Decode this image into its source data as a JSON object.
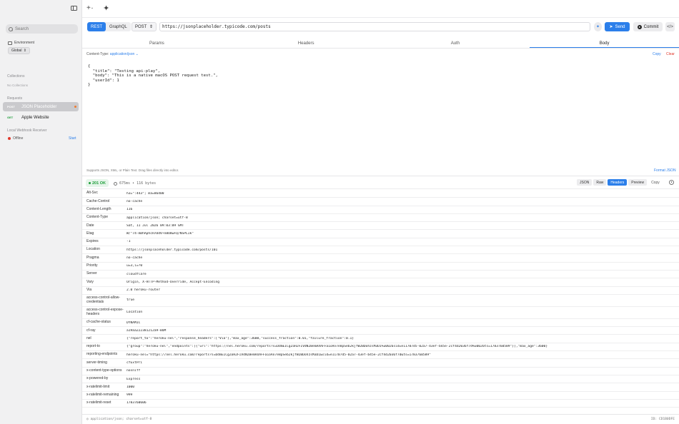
{
  "sidebar": {
    "search_placeholder": "Search",
    "environment_label": "Environment",
    "environment_value": "Global",
    "collections_title": "Collections",
    "collections_empty": "No Collections",
    "requests_title": "Requests",
    "requests": [
      {
        "method": "POST",
        "name": "JSON Placeholder",
        "selected": true,
        "modified": true
      },
      {
        "method": "GET",
        "name": "Apple Website",
        "selected": false,
        "modified": false
      }
    ],
    "webhook_title": "Local Webhook Receiver",
    "webhook_status": "Offline",
    "webhook_start": "Start"
  },
  "topbar": {
    "add_icon": "+",
    "chevron": "⌄",
    "sparkle_icon": "✦"
  },
  "request": {
    "modes": [
      "REST",
      "GraphQL"
    ],
    "active_mode": "REST",
    "method": "POST",
    "url": "https://jsonplaceholder.typicode.com/posts",
    "send_label": "Send",
    "commit_label": "Commit",
    "code_icon": "</>",
    "tabs": [
      "Params",
      "Headers",
      "Auth",
      "Body"
    ],
    "active_tab": "Body",
    "content_type_label": "Content-Type:",
    "content_type_value": "application/json",
    "copy_label": "Copy",
    "clear_label": "Clear",
    "body_lines": [
      "{",
      "  \"title\": \"Testing api-play\",",
      "  \"body\": \"This is a native macOS POST request test.\",",
      "  \"userId\": 1",
      "}"
    ],
    "hint": "Supports JSON, XML, or Plain Text. Drag files directly into editor.",
    "format_label": "Format JSON"
  },
  "response": {
    "status": "201 OK",
    "timing": "675ms • 116 bytes",
    "views": [
      "JSON",
      "Raw",
      "Headers",
      "Preview"
    ],
    "active_view": "Headers",
    "copy_label": "Copy",
    "headers": [
      {
        "key": "Alt-Svc",
        "value": "h3=\":443\"; ma=86400"
      },
      {
        "key": "Cache-Control",
        "value": "no-cache"
      },
      {
        "key": "Content-Length",
        "value": "116"
      },
      {
        "key": "Content-Type",
        "value": "application/json; charset=utf-8"
      },
      {
        "key": "Date",
        "value": "Sat, 11 Jul 2026 09:03:09 GMT"
      },
      {
        "key": "Etag",
        "value": "W/\"74-mDhAphcH7DdV+nBU8wFQ/NSPLIk\""
      },
      {
        "key": "Expires",
        "value": "-1"
      },
      {
        "key": "Location",
        "value": "https://jsonplaceholder.typicode.com/posts/101"
      },
      {
        "key": "Pragma",
        "value": "no-cache"
      },
      {
        "key": "Priority",
        "value": "u=3,i=?0"
      },
      {
        "key": "Server",
        "value": "cloudflare"
      },
      {
        "key": "Vary",
        "value": "Origin, X-HTTP-Method-Override, Accept-Encoding"
      },
      {
        "key": "Via",
        "value": "2.0 heroku-router"
      },
      {
        "key": "access-control-allow-credentials",
        "value": "true",
        "tall": true
      },
      {
        "key": "access-control-expose-headers",
        "value": "Location",
        "tall": true
      },
      {
        "key": "cf-cache-status",
        "value": "DYNAMIC"
      },
      {
        "key": "cf-ray",
        "value": "a19aa222381212a9-BOM"
      },
      {
        "key": "nel",
        "value": "{\"report_to\":\"heroku-nel\",\"response_headers\":[\"Via\"],\"max_age\":3600,\"success_fraction\":0.01,\"failure_fraction\":0.1}"
      },
      {
        "key": "report-to",
        "value": "{\"group\":\"heroku-nel\",\"endpoints\":[{\"url\":\"https://nel.heroku.com/reports?s=DdmEICgZoH2FIVdN2BemAXAFFa1oAn7e8pSeb2kjfW2BDohzsM3D1%u0026sid=e11707d5-02a7-43ef-b45e-2cf4d2036f7d%u0026ts=1783760589\"}],\"max_age\":3600}"
      },
      {
        "key": "reporting-endpoints",
        "value": "heroku-nel=\"https://nel.heroku.com/reports?s=DdmEICgZoH2FIVdN2BemAXAFFa1oAn7e8pSeb2kjfW2BDohzsM3D1&sid=e11707d5-02a7-43ef-b45e-2cf4d2036f7d&ts=1783760589\""
      },
      {
        "key": "server-timing",
        "value": "cfExtPri"
      },
      {
        "key": "x-content-type-options",
        "value": "nosniff"
      },
      {
        "key": "x-powered-by",
        "value": "Express"
      },
      {
        "key": "x-ratelimit-limit",
        "value": "1000"
      },
      {
        "key": "x-ratelimit-remaining",
        "value": "999"
      },
      {
        "key": "x-ratelimit-reset",
        "value": "1783760606"
      }
    ]
  },
  "footer": {
    "left": "◎ application/json; charset=utf-8",
    "right": "ID: CD1B0DFE"
  },
  "colors": {
    "accent": "#2c7fea",
    "success": "#1f9e3a",
    "danger": "#e0382b",
    "modified": "#ef7b2f"
  }
}
